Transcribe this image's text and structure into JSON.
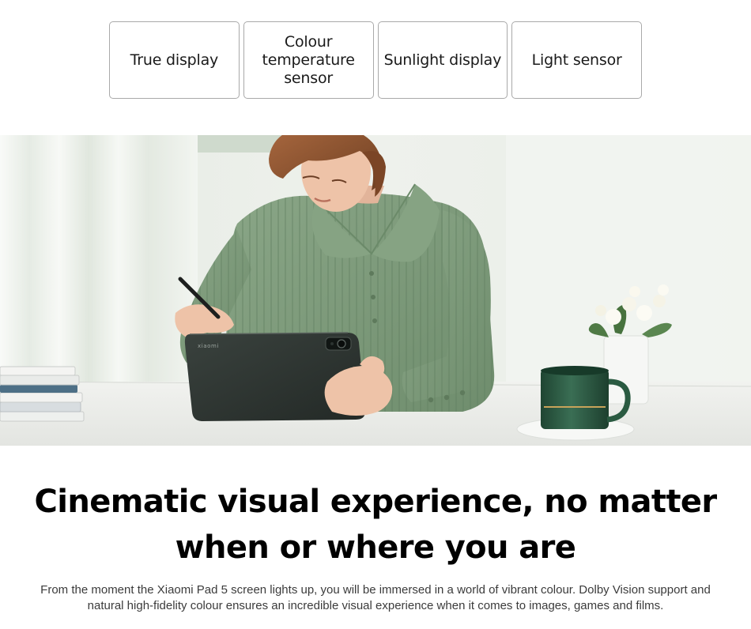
{
  "features": [
    {
      "label": "True display"
    },
    {
      "label": "Colour temperature sensor"
    },
    {
      "label": "Sunlight display"
    },
    {
      "label": "Light sensor"
    }
  ],
  "hero": {
    "tablet_brand": "xiaomi"
  },
  "headline": "Cinematic visual experience, no matter when or where you are",
  "description": "From the moment the Xiaomi Pad 5 screen lights up, you will be immersed in a world of vibrant colour. Dolby Vision support and natural high-fidelity colour ensures an incredible visual experience when it comes to images, games and films.",
  "colors": {
    "sweater_green": "#7f9d7c",
    "tablet_dark": "#2d3431",
    "mug_green": "#2d5a43",
    "background": "#ffffff"
  }
}
